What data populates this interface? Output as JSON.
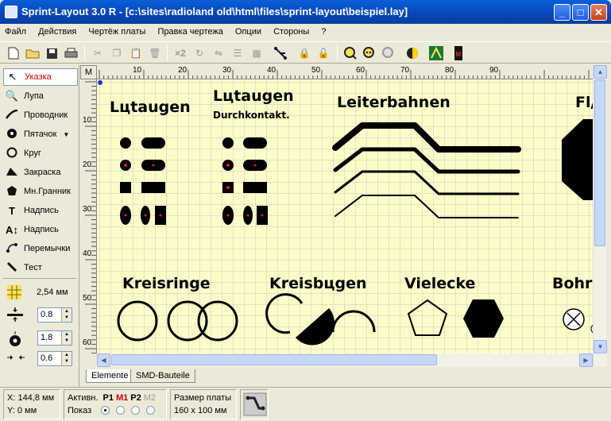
{
  "window": {
    "title": "Sprint-Layout 3.0 R - [c:\\sites\\radioland old\\html\\files\\sprint-layout\\beispiel.lay]",
    "min": "_",
    "max": "□",
    "close": "✕"
  },
  "menu": [
    "Файл",
    "Действия",
    "Чертёж платы",
    "Правка чертежа",
    "Опции",
    "Стороны",
    "?"
  ],
  "tools": [
    {
      "label": "Указка",
      "icon": "pointer-icon"
    },
    {
      "label": "Лупа",
      "icon": "magnifier-icon"
    },
    {
      "label": "Проводник",
      "icon": "track-icon"
    },
    {
      "label": "Пятачок",
      "icon": "pad-icon"
    },
    {
      "label": "Круг",
      "icon": "circle-icon"
    },
    {
      "label": "Закраска",
      "icon": "fill-icon"
    },
    {
      "label": "Мн.Гранник",
      "icon": "polygon-icon"
    },
    {
      "label": "Надпись",
      "icon": "text-icon"
    },
    {
      "label": "Надпись",
      "icon": "text-vertical-icon"
    },
    {
      "label": "Перемычки",
      "icon": "jumper-icon"
    },
    {
      "label": "Тест",
      "icon": "test-icon"
    }
  ],
  "grid": {
    "value": "2,54 мм"
  },
  "spinners": {
    "track_width": "0.8",
    "pad_outer": "1.8",
    "pad_inner": "0.6"
  },
  "rulers": {
    "m_label": "M",
    "top_ticks": [
      "10",
      "20",
      "30",
      "40",
      "50",
      "60",
      "70",
      "80",
      "90"
    ],
    "left_ticks": [
      "10",
      "20",
      "30",
      "40",
      "50",
      "60"
    ]
  },
  "canvas": {
    "labels": {
      "lotaugen1": "Lцtaugen",
      "lotaugen2": "Lцtaugen",
      "durchkontakt": "Durchkontakt.",
      "leiterbahnen": "Leiterbahnen",
      "flaeche": "Fl/",
      "kreisringe": "Kreisringe",
      "kreisboegen": "Kreisbцgen",
      "vielecke": "Vielecke",
      "bohr": "Bohru"
    }
  },
  "tabs": [
    "Elemente",
    "SMD-Bauteile"
  ],
  "status": {
    "x": "X: 144,8 мм",
    "y": "Y: 0 мм",
    "active_label": "Активн.",
    "show_label": "Показ",
    "layers": [
      "P1",
      "M1",
      "P2",
      "M2"
    ],
    "layer_colors": [
      "#000000",
      "#cc0000",
      "#000000",
      "#999999"
    ],
    "board_size_label": "Размер платы",
    "board_size_value": "160 x 100 мм"
  }
}
